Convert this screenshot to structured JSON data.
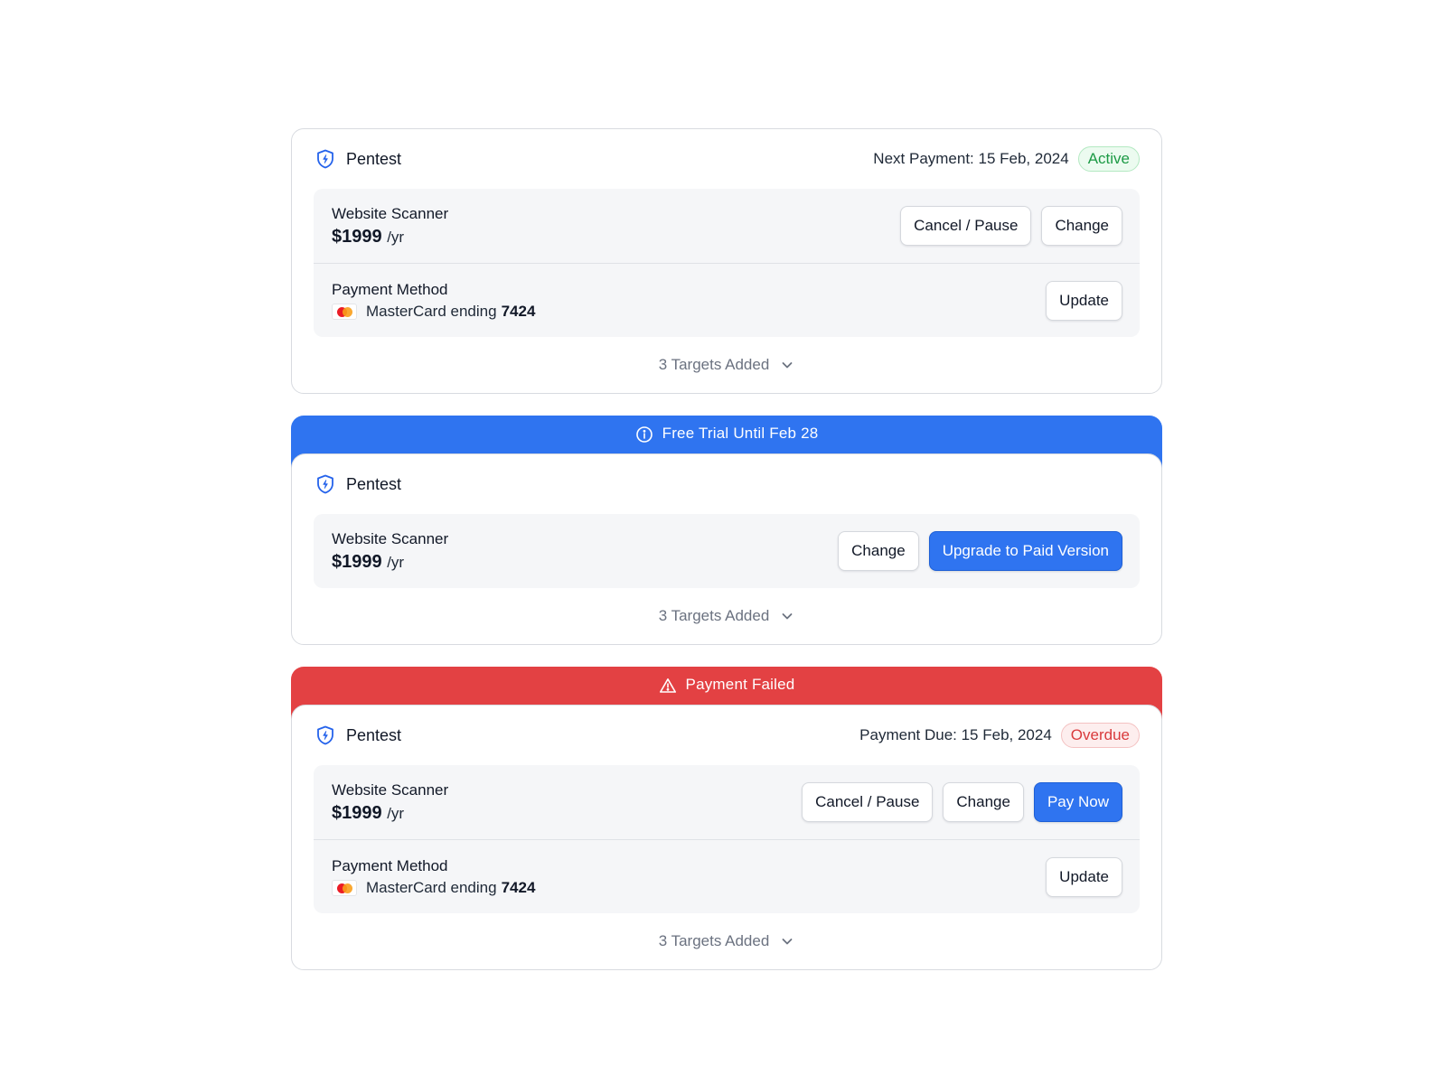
{
  "subscriptions": [
    {
      "product": "Pentest",
      "date_text": "Next Payment: 15 Feb, 2024",
      "status": "Active",
      "plan": {
        "name": "Website Scanner",
        "price": "$1999",
        "period": "/yr"
      },
      "buttons": [
        "Cancel / Pause",
        "Change"
      ],
      "payment": {
        "label": "Payment Method",
        "card_text": "MasterCard ending",
        "last4": "7424",
        "button": "Update"
      },
      "footer": "3 Targets Added"
    },
    {
      "banner": "Free Trial Until Feb 28",
      "banner_icon": "info-icon",
      "product": "Pentest",
      "plan": {
        "name": "Website Scanner",
        "price": "$1999",
        "period": "/yr"
      },
      "buttons": [
        "Change",
        "Upgrade to Paid Version"
      ],
      "footer": "3 Targets Added"
    },
    {
      "banner": "Payment Failed",
      "banner_icon": "warning-icon",
      "product": "Pentest",
      "date_text": "Payment Due: 15 Feb, 2024",
      "status": "Overdue",
      "plan": {
        "name": "Website Scanner",
        "price": "$1999",
        "period": "/yr"
      },
      "buttons": [
        "Cancel / Pause",
        "Change",
        "Pay Now"
      ],
      "payment": {
        "label": "Payment Method",
        "card_text": "MasterCard ending",
        "last4": "7424",
        "button": "Update"
      },
      "footer": "3 Targets Added"
    }
  ],
  "colors": {
    "accent_blue": "#2f74f0",
    "danger_red": "#e34143",
    "active_green": "#1c9a45",
    "overdue_red": "#d93a3c"
  }
}
